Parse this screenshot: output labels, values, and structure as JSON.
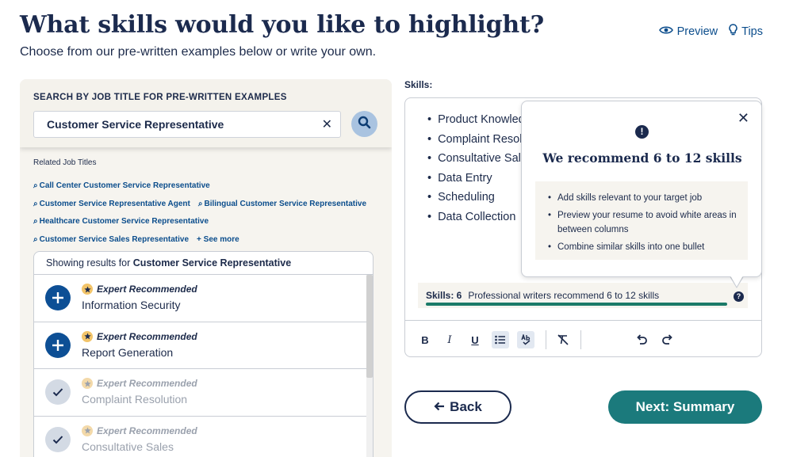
{
  "header": {
    "title": "What skills would you like to highlight?",
    "subtitle": "Choose from our pre-written examples below or write your own.",
    "preview_label": "Preview",
    "tips_label": "Tips"
  },
  "search": {
    "heading": "SEARCH BY JOB TITLE FOR PRE-WRITTEN EXAMPLES",
    "value": "Customer Service Representative",
    "clear_label": "✕"
  },
  "related": {
    "title": "Related Job Titles",
    "items": [
      "Call Center Customer Service Representative",
      "Customer Service Representative Agent",
      "Bilingual Customer Service Representative",
      "Healthcare Customer Service Representative",
      "Customer Service Sales Representative"
    ],
    "see_more": "+ See more"
  },
  "results": {
    "prefix": "Showing results for ",
    "query": "Customer Service Representative",
    "badge": "Expert Recommended",
    "items": [
      {
        "name": "Information Security",
        "state": "add"
      },
      {
        "name": "Report Generation",
        "state": "add"
      },
      {
        "name": "Complaint Resolution",
        "state": "added"
      },
      {
        "name": "Consultative Sales",
        "state": "added"
      }
    ]
  },
  "editor": {
    "label": "Skills:",
    "skills": [
      "Product Knowled",
      "Complaint Resolu",
      "Consultative Sale",
      "Data Entry",
      "Scheduling",
      "Data Collection"
    ],
    "count_label": "Skills: 6",
    "count_value": 6,
    "recommend_text": "Professional writers recommend 6 to 12 skills",
    "help": "?",
    "toolbar": {
      "bold": "B",
      "italic": "I",
      "underline": "U"
    }
  },
  "tooltip": {
    "alert": "!",
    "title": "We recommend 6 to 12 skills",
    "close": "✕",
    "tips": [
      "Add skills relevant to your target job",
      "Preview your resume to avoid white areas in between columns",
      "Combine similar skills into one bullet"
    ]
  },
  "nav": {
    "back_label": "Back",
    "next_label": "Next: Summary"
  },
  "colors": {
    "navy": "#1b2a4e",
    "link": "#0b4d8c",
    "teal": "#1b7a7c",
    "progress": "#1b7a68",
    "panel_bg": "#f6f4ef"
  }
}
